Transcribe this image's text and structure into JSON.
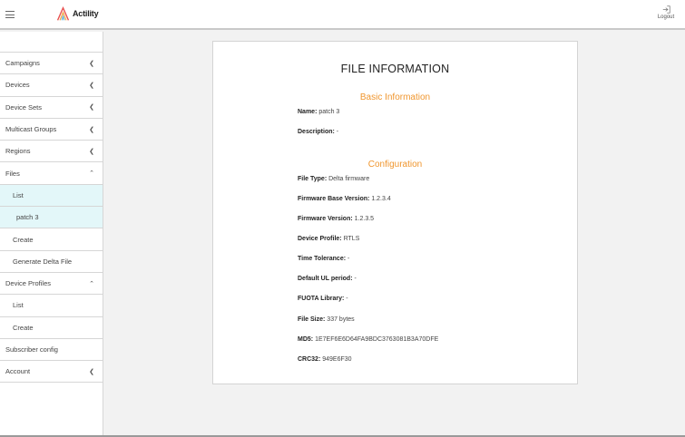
{
  "header": {
    "brand": "Actility",
    "logout_label": "Logout"
  },
  "sidebar": {
    "items": [
      {
        "label": "Campaigns"
      },
      {
        "label": "Devices"
      },
      {
        "label": "Device Sets"
      },
      {
        "label": "Multicast Groups"
      },
      {
        "label": "Regions"
      },
      {
        "label": "Files"
      },
      {
        "label": "List"
      },
      {
        "label": "patch 3"
      },
      {
        "label": "Create"
      },
      {
        "label": "Generate Delta File"
      },
      {
        "label": "Device Profiles"
      },
      {
        "label": "List"
      },
      {
        "label": "Create"
      },
      {
        "label": "Subscriber config"
      },
      {
        "label": "Account"
      }
    ]
  },
  "main": {
    "title": "FILE INFORMATION",
    "basic_heading": "Basic Information",
    "config_heading": "Configuration",
    "fields": {
      "name": {
        "label": "Name:",
        "value": "patch 3"
      },
      "description": {
        "label": "Description:",
        "value": "-"
      },
      "file_type": {
        "label": "File Type:",
        "value": "Delta firmware"
      },
      "fw_base_version": {
        "label": "Firmware Base Version:",
        "value": "1.2.3.4"
      },
      "fw_version": {
        "label": "Firmware Version:",
        "value": "1.2.3.5"
      },
      "device_profile": {
        "label": "Device Profile:",
        "value": "RTLS"
      },
      "time_tolerance": {
        "label": "Time Tolerance:",
        "value": "-"
      },
      "default_ul_period": {
        "label": "Default UL period:",
        "value": "-"
      },
      "fuota_library": {
        "label": "FUOTA Library:",
        "value": "-"
      },
      "file_size": {
        "label": "File Size:",
        "value": "337 bytes"
      },
      "md5": {
        "label": "MD5:",
        "value": "1E7EF6E6D64FA9BDC3763081B3A70DFE"
      },
      "crc32": {
        "label": "CRC32:",
        "value": "949E6F30"
      }
    }
  },
  "colors": {
    "accent_orange": "#f0962e",
    "active_bg": "#e3f7f9"
  },
  "icons": {
    "menu": "hamburger-icon",
    "logout": "logout-icon",
    "collapsed": "chevron-left-icon",
    "expanded": "chevron-up-icon"
  }
}
